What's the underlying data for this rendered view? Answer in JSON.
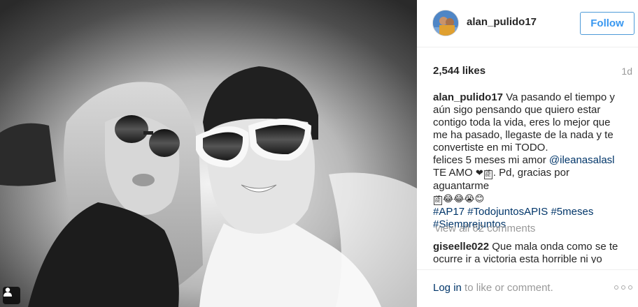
{
  "post": {
    "username": "alan_pulido17",
    "follow_label": "Follow",
    "likes": "2,544 likes",
    "time": "1d",
    "caption": {
      "author": "alan_pulido17",
      "text_1": "Va pasando el tiempo y aún sigo pensando que quiero estar contigo toda la vida, eres lo mejor que me ha pasado, llegaste de la nada y te convertiste en mi TODO.",
      "text_2": "felices 5 meses mi amor",
      "mention": "@ileanasalasl",
      "text_3": "TE AMO",
      "text_4": ". Pd, gracias por aguantarme",
      "emojis": "😂😂😭😊",
      "hashtag_1": "#AP17",
      "hashtag_2": "#TodojuntosAPIS",
      "hashtag_3": "#5meses",
      "hashtag_4": "#Siemprejuntos"
    },
    "view_comments": "view all 62 comments",
    "comment": {
      "author": "giseelle022",
      "text": "Que mala onda como se te ocurre ir a victoria esta horrible ni yo voy"
    },
    "footer": {
      "login_link": "Log in",
      "login_text": "to like or comment."
    }
  },
  "icons": {
    "user_tag": "user-tag-icon",
    "more": "more-options-icon",
    "heart": "heart-emoji"
  },
  "colors": {
    "follow_blue": "#3897f0",
    "link_navy": "#003569",
    "muted_gray": "#999999"
  }
}
